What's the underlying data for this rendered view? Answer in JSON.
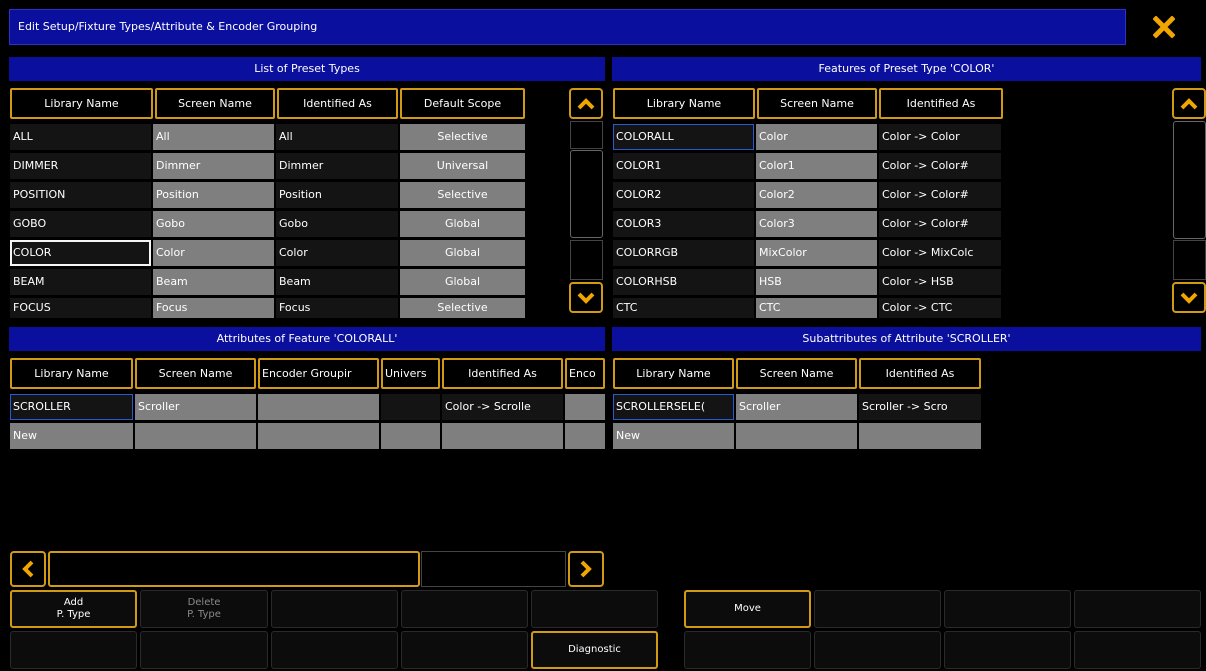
{
  "window": {
    "title": "Edit Setup/Fixture Types/Attribute & Encoder Grouping"
  },
  "preset_types": {
    "title": "List of Preset Types",
    "headers": [
      "Library Name",
      "Screen Name",
      "Identified As",
      "Default Scope"
    ],
    "rows": [
      [
        "ALL",
        "All",
        "All",
        "Selective"
      ],
      [
        "DIMMER",
        "Dimmer",
        "Dimmer",
        "Universal"
      ],
      [
        "POSITION",
        "Position",
        "Position",
        "Selective"
      ],
      [
        "GOBO",
        "Gobo",
        "Gobo",
        "Global"
      ],
      [
        "COLOR",
        "Color",
        "Color",
        "Global"
      ],
      [
        "BEAM",
        "Beam",
        "Beam",
        "Global"
      ],
      [
        "FOCUS",
        "Focus",
        "Focus",
        "Selective"
      ]
    ]
  },
  "features": {
    "title": "Features of Preset Type 'COLOR'",
    "headers": [
      "Library Name",
      "Screen Name",
      "Identified As"
    ],
    "rows": [
      [
        "COLORALL",
        "Color",
        "Color -> Color"
      ],
      [
        "COLOR1",
        "Color1",
        "Color -> Color#"
      ],
      [
        "COLOR2",
        "Color2",
        "Color -> Color#"
      ],
      [
        "COLOR3",
        "Color3",
        "Color -> Color#"
      ],
      [
        "COLORRGB",
        "MixColor",
        "Color -> MixColc"
      ],
      [
        "COLORHSB",
        "HSB",
        "Color -> HSB"
      ],
      [
        "CTC",
        "CTC",
        "Color -> CTC"
      ]
    ]
  },
  "attributes": {
    "title": "Attributes of Feature 'COLORALL'",
    "headers": [
      "Library Name",
      "Screen Name",
      "Encoder Groupir",
      "Univers",
      "Identified As",
      "Enco"
    ],
    "rows": [
      [
        "SCROLLER",
        "Scroller",
        "",
        "",
        "Color -> Scrolle",
        ""
      ],
      [
        "New",
        "",
        "",
        "",
        "",
        ""
      ]
    ]
  },
  "subattributes": {
    "title": "Subattributes of Attribute 'SCROLLER'",
    "headers": [
      "Library Name",
      "Screen Name",
      "Identified As"
    ],
    "rows": [
      [
        "SCROLLERSELE(",
        "Scroller",
        "Scroller -> Scro"
      ],
      [
        "New",
        "",
        ""
      ]
    ]
  },
  "buttons": {
    "add_line1": "Add",
    "add_line2": "P. Type",
    "delete_line1": "Delete",
    "delete_line2": "P. Type",
    "diagnostic": "Diagnostic",
    "move": "Move"
  },
  "colors": {
    "accent": "#d09a14",
    "title_blue": "#0b0f9e",
    "gray_cell": "#7f7f7f",
    "dark_cell": "#141414"
  }
}
